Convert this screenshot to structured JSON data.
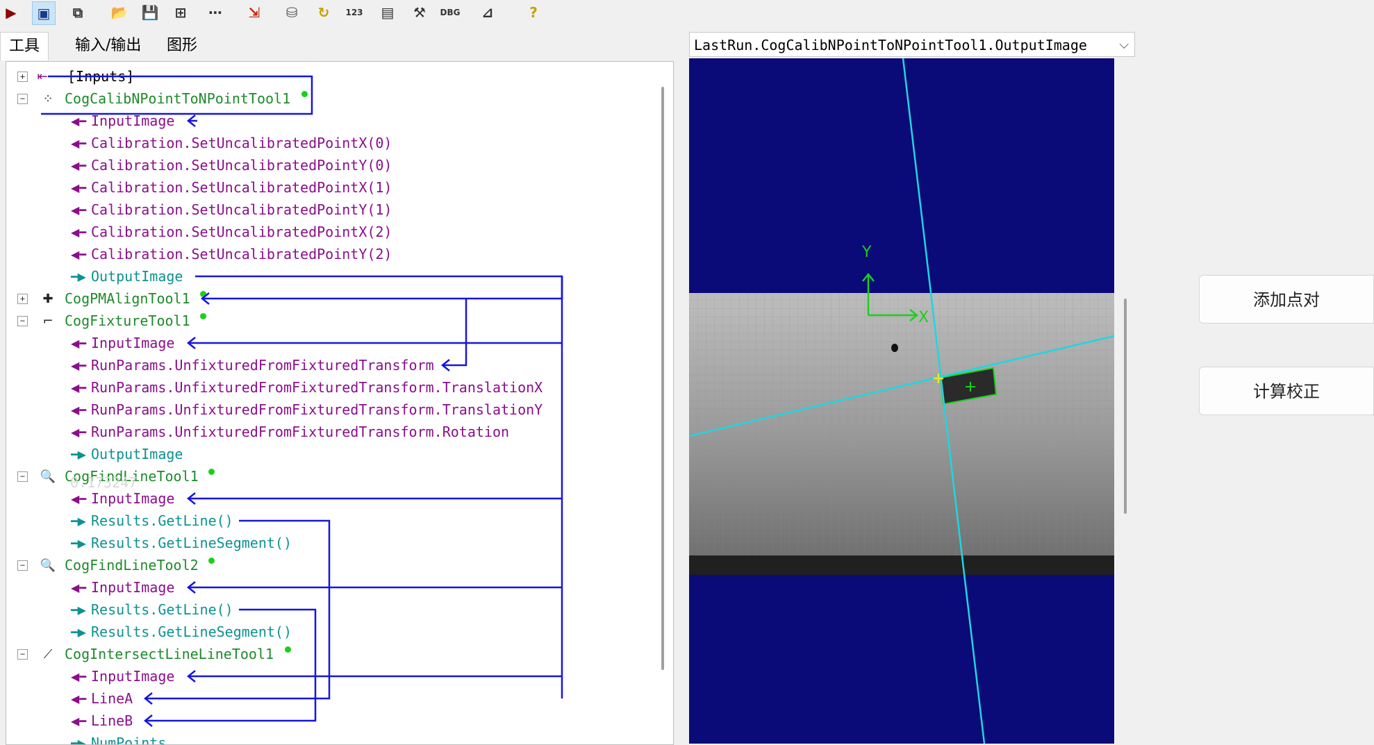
{
  "toolbar": {
    "buttons": [
      {
        "name": "run-icon",
        "glyph": "▶",
        "color": "#8b0000"
      },
      {
        "name": "display-icon",
        "glyph": "▣",
        "color": "#1a3a8a"
      },
      {
        "name": "copy-icon",
        "glyph": "⧉",
        "color": "#333333"
      },
      {
        "name": "open-icon",
        "glyph": "📂",
        "color": "#b08000"
      },
      {
        "name": "save-icon",
        "glyph": "💾",
        "color": "#222222"
      },
      {
        "name": "tree-icon",
        "glyph": "⊞",
        "color": "#333333"
      },
      {
        "name": "dots-icon",
        "glyph": "⋯",
        "color": "#333333"
      },
      {
        "name": "import-icon",
        "glyph": "⇲",
        "color": "#cc2200"
      },
      {
        "name": "database-icon",
        "glyph": "⛁",
        "color": "#555555"
      },
      {
        "name": "refresh-icon",
        "glyph": "↻",
        "color": "#c8a000"
      },
      {
        "name": "numeric-icon",
        "glyph": "123",
        "color": "#333333"
      },
      {
        "name": "terminal-icon",
        "glyph": "▤",
        "color": "#333333"
      },
      {
        "name": "tools-icon",
        "glyph": "⚒",
        "color": "#333333"
      },
      {
        "name": "debug-icon",
        "glyph": "DBG",
        "color": "#333333"
      },
      {
        "name": "measure-icon",
        "glyph": "⊿",
        "color": "#333333"
      },
      {
        "name": "help-icon",
        "glyph": "?",
        "color": "#c8a000"
      }
    ]
  },
  "tabs": [
    "工具",
    "输入/输出",
    "图形"
  ],
  "tree": [
    {
      "text": "[Inputs]",
      "kind": "root",
      "color": "black",
      "expander": "+"
    },
    {
      "text": "CogCalibNPointToNPointTool1",
      "kind": "tool",
      "color": "green",
      "expander": "−",
      "icon": "calib-icon",
      "dot": true
    },
    {
      "text": "InputImage",
      "kind": "in",
      "color": "purple"
    },
    {
      "text": "Calibration.SetUncalibratedPointX(0)",
      "kind": "in",
      "color": "purple"
    },
    {
      "text": "Calibration.SetUncalibratedPointY(0)",
      "kind": "in",
      "color": "purple"
    },
    {
      "text": "Calibration.SetUncalibratedPointX(1)",
      "kind": "in",
      "color": "purple"
    },
    {
      "text": "Calibration.SetUncalibratedPointY(1)",
      "kind": "in",
      "color": "purple"
    },
    {
      "text": "Calibration.SetUncalibratedPointX(2)",
      "kind": "in",
      "color": "purple"
    },
    {
      "text": "Calibration.SetUncalibratedPointY(2)",
      "kind": "in",
      "color": "purple"
    },
    {
      "text": "OutputImage",
      "kind": "out",
      "color": "teal"
    },
    {
      "text": "CogPMAlignTool1",
      "kind": "tool",
      "color": "green",
      "expander": "+",
      "icon": "pmalign-icon",
      "dot": true
    },
    {
      "text": "CogFixtureTool1",
      "kind": "tool",
      "color": "green",
      "expander": "−",
      "icon": "fixture-icon",
      "dot": true
    },
    {
      "text": "InputImage",
      "kind": "in",
      "color": "purple"
    },
    {
      "text": "RunParams.UnfixturedFromFixturedTransform",
      "kind": "in",
      "color": "purple"
    },
    {
      "text": "RunParams.UnfixturedFromFixturedTransform.TranslationX",
      "kind": "in",
      "color": "purple"
    },
    {
      "text": "RunParams.UnfixturedFromFixturedTransform.TranslationY",
      "kind": "in",
      "color": "purple"
    },
    {
      "text": "RunParams.UnfixturedFromFixturedTransform.Rotation",
      "kind": "in",
      "color": "purple"
    },
    {
      "text": "OutputImage",
      "kind": "out",
      "color": "teal"
    },
    {
      "text": "CogFindLineTool1",
      "kind": "tool",
      "color": "green",
      "expander": "−",
      "icon": "findline-icon",
      "dot": true
    },
    {
      "text": "InputImage",
      "kind": "in",
      "color": "purple"
    },
    {
      "text": "Results.GetLine()",
      "kind": "out",
      "color": "teal"
    },
    {
      "text": "Results.GetLineSegment()",
      "kind": "out",
      "color": "teal"
    },
    {
      "text": "CogFindLineTool2",
      "kind": "tool",
      "color": "green",
      "expander": "−",
      "icon": "findline-icon",
      "dot": true
    },
    {
      "text": "InputImage",
      "kind": "in",
      "color": "purple"
    },
    {
      "text": "Results.GetLine()",
      "kind": "out",
      "color": "teal"
    },
    {
      "text": "Results.GetLineSegment()",
      "kind": "out",
      "color": "teal"
    },
    {
      "text": "CogIntersectLineLineTool1",
      "kind": "tool",
      "color": "green",
      "expander": "−",
      "icon": "intersect-icon",
      "dot": true
    },
    {
      "text": "InputImage",
      "kind": "in",
      "color": "purple"
    },
    {
      "text": "LineA",
      "kind": "in",
      "color": "purple"
    },
    {
      "text": "LineB",
      "kind": "in",
      "color": "purple"
    },
    {
      "text": "NumPoints",
      "kind": "out",
      "color": "teal"
    }
  ],
  "tooltip_ghost": "0.173247",
  "image_selector": {
    "value": "LastRun.CogCalibNPointToNPointTool1.OutputImage"
  },
  "display": {
    "axis_x_label": "X",
    "axis_y_label": "Y",
    "background": "#0a0a78",
    "line_color": "#1fd6e0",
    "graphic_color": "#1ad01a"
  },
  "buttons": {
    "add_pair": "添加点对",
    "compute": "计算校正"
  },
  "colors": {
    "tool": "#1d8a2a",
    "input": "#8b0e8b",
    "output": "#0d9191",
    "link": "#1515e0"
  }
}
